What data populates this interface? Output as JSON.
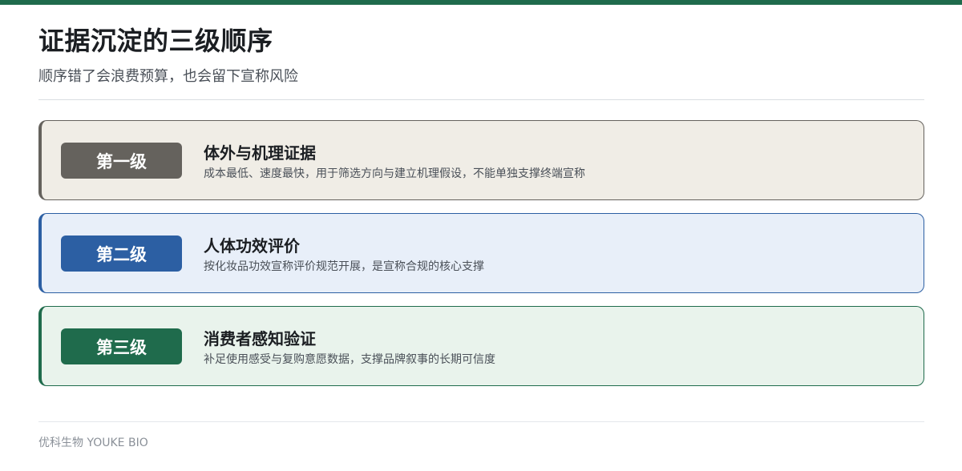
{
  "header": {
    "title": "证据沉淀的三级顺序",
    "subtitle": "顺序错了会浪费预算，也会留下宣称风险"
  },
  "colors": {
    "accent": "#1f6b4c"
  },
  "levels": [
    {
      "badge": "第一级",
      "title": "体外与机理证据",
      "desc": "成本最低、速度最快，用于筛选方向与建立机理假设，不能单独支撑终端宣称",
      "badge_color": "#65625d",
      "border_color": "#65625d",
      "bg_color": "#f0ede6"
    },
    {
      "badge": "第二级",
      "title": "人体功效评价",
      "desc": "按化妆品功效宣称评价规范开展，是宣称合规的核心支撑",
      "badge_color": "#2c5fa3",
      "border_color": "#2c5fa3",
      "bg_color": "#e8eff9"
    },
    {
      "badge": "第三级",
      "title": "消费者感知验证",
      "desc": "补足使用感受与复购意愿数据，支撑品牌叙事的长期可信度",
      "badge_color": "#1f6b4c",
      "border_color": "#1f6b4c",
      "bg_color": "#e9f3ec"
    }
  ],
  "footer": {
    "brand": "优科生物 YOUKE BIO"
  }
}
